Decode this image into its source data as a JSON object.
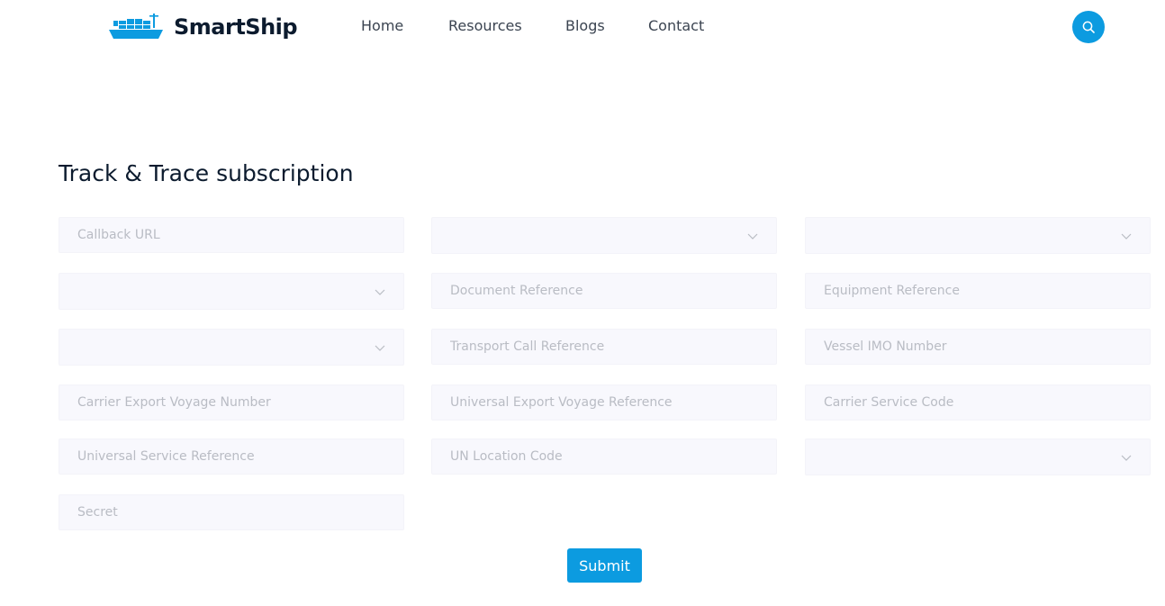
{
  "brand": {
    "name": "SmartShip",
    "logo_icon": "container-ship-icon",
    "accent_color": "#0c9be0"
  },
  "nav": {
    "items": [
      {
        "label": "Home"
      },
      {
        "label": "Resources"
      },
      {
        "label": "Blogs"
      },
      {
        "label": "Contact"
      }
    ],
    "search_icon": "search-icon"
  },
  "form": {
    "title": "Track & Trace subscription",
    "fields": {
      "callback_url": {
        "placeholder": "Callback URL"
      },
      "select_1": {
        "value": ""
      },
      "select_2": {
        "value": ""
      },
      "select_3": {
        "value": ""
      },
      "document_reference": {
        "placeholder": "Document Reference"
      },
      "equipment_reference": {
        "placeholder": "Equipment Reference"
      },
      "select_4": {
        "value": ""
      },
      "transport_call_reference": {
        "placeholder": "Transport Call Reference"
      },
      "vessel_imo_number": {
        "placeholder": "Vessel IMO Number"
      },
      "carrier_export_voyage_number": {
        "placeholder": "Carrier Export Voyage Number"
      },
      "universal_export_voyage_reference": {
        "placeholder": "Universal Export Voyage Reference"
      },
      "carrier_service_code": {
        "placeholder": "Carrier Service Code"
      },
      "universal_service_reference": {
        "placeholder": "Universal Service Reference"
      },
      "un_location_code": {
        "placeholder": "UN Location Code"
      },
      "select_5": {
        "value": ""
      },
      "secret": {
        "placeholder": "Secret"
      }
    },
    "submit_label": "Submit"
  }
}
